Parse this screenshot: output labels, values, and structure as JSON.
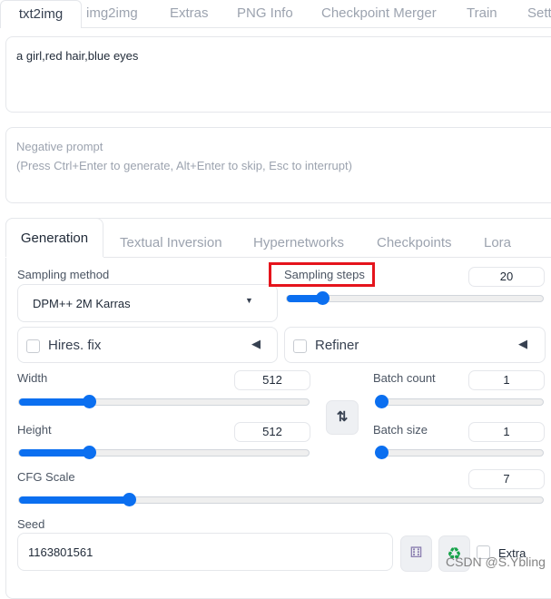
{
  "tabs": [
    "txt2img",
    "img2img",
    "Extras",
    "PNG Info",
    "Checkpoint Merger",
    "Train",
    "Settings"
  ],
  "prompt": "a girl,red hair,blue eyes",
  "negative": {
    "label": "Negative prompt",
    "placeholder": "(Press Ctrl+Enter to generate, Alt+Enter to skip, Esc to interrupt)"
  },
  "subtabs": [
    "Generation",
    "Textual Inversion",
    "Hypernetworks",
    "Checkpoints",
    "Lora"
  ],
  "sampling_method": {
    "label": "Sampling method",
    "value": "DPM++ 2M Karras"
  },
  "sampling_steps": {
    "label": "Sampling steps",
    "value": "20",
    "level_pct": 14
  },
  "hires": {
    "label": "Hires. fix",
    "checked": false
  },
  "refiner": {
    "label": "Refiner",
    "checked": false
  },
  "width": {
    "label": "Width",
    "value": "512",
    "level_pct": 24
  },
  "height": {
    "label": "Height",
    "value": "512",
    "level_pct": 24
  },
  "batch_count": {
    "label": "Batch count",
    "value": "1",
    "level_pct": 0
  },
  "batch_size": {
    "label": "Batch size",
    "value": "1",
    "level_pct": 0
  },
  "cfg": {
    "label": "CFG Scale",
    "value": "7",
    "level_pct": 21
  },
  "seed": {
    "label": "Seed",
    "value": "1163801561"
  },
  "extra": {
    "label": "Extra",
    "checked": false
  },
  "watermark": "CSDN @S.Ybling",
  "colors": {
    "accent": "#0b6ff0",
    "highlight": "#e5141c"
  }
}
